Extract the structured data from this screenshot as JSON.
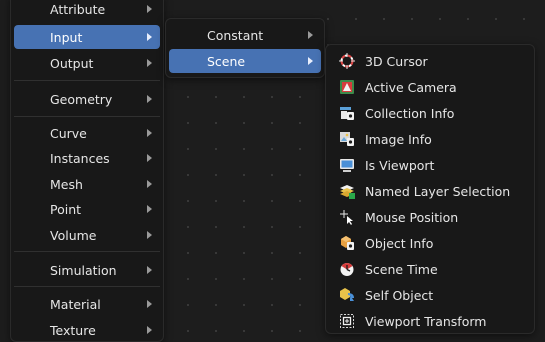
{
  "main_menu": {
    "items": [
      {
        "label": "Attribute",
        "submenu": true
      },
      {
        "label": "Input",
        "submenu": true,
        "active": true
      },
      {
        "label": "Output",
        "submenu": true
      },
      {
        "label": "Geometry",
        "submenu": true
      },
      {
        "label": "Curve",
        "submenu": true
      },
      {
        "label": "Instances",
        "submenu": true
      },
      {
        "label": "Mesh",
        "submenu": true
      },
      {
        "label": "Point",
        "submenu": true
      },
      {
        "label": "Volume",
        "submenu": true
      },
      {
        "label": "Simulation",
        "submenu": true
      },
      {
        "label": "Material",
        "submenu": true
      },
      {
        "label": "Texture",
        "submenu": true
      }
    ]
  },
  "input_menu": {
    "items": [
      {
        "label": "Constant",
        "submenu": true
      },
      {
        "label": "Scene",
        "submenu": true,
        "active": true
      }
    ]
  },
  "scene_menu": {
    "items": [
      {
        "label": "3D Cursor",
        "icon": "cursor-3d-icon"
      },
      {
        "label": "Active Camera",
        "icon": "camera-icon"
      },
      {
        "label": "Collection Info",
        "icon": "collection-info-icon"
      },
      {
        "label": "Image Info",
        "icon": "image-info-icon"
      },
      {
        "label": "Is Viewport",
        "icon": "viewport-icon"
      },
      {
        "label": "Named Layer Selection",
        "icon": "layer-selection-icon"
      },
      {
        "label": "Mouse Position",
        "icon": "mouse-position-icon"
      },
      {
        "label": "Object Info",
        "icon": "object-info-icon"
      },
      {
        "label": "Scene Time",
        "icon": "scene-time-icon"
      },
      {
        "label": "Self Object",
        "icon": "self-object-icon"
      },
      {
        "label": "Viewport Transform",
        "icon": "viewport-transform-icon"
      }
    ]
  },
  "colors": {
    "highlight": "#4772b3",
    "menu_bg": "#181818",
    "canvas_bg": "#1d1d1d"
  }
}
